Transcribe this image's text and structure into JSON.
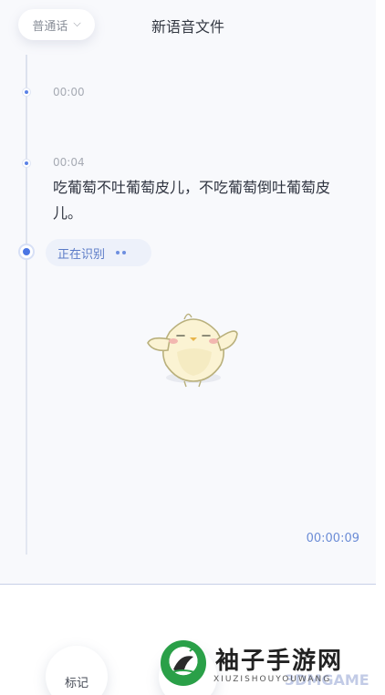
{
  "header": {
    "language_label": "普通话",
    "language_chevron_icon": "chevron-down-icon",
    "title": "新语音文件"
  },
  "timeline": {
    "entries": [
      {
        "timestamp": "00:00",
        "text": ""
      },
      {
        "timestamp": "00:04",
        "text": "吃葡萄不吐葡萄皮儿，不吃葡萄倒吐葡萄皮儿。"
      }
    ],
    "recognizing_label": "正在识别"
  },
  "mascot": {
    "icon": "chick-mascot-icon"
  },
  "recording": {
    "elapsed": "00:00:09"
  },
  "footer": {
    "mark_label": "标记"
  },
  "watermark": {
    "title": "袖子手游网",
    "subtitle": "XIUZISHOUYOUWANG",
    "overlay": "3DMGAME"
  },
  "colors": {
    "accent": "#4b76e4",
    "background": "#f8f9fc",
    "text_primary": "#2f3440",
    "timestamp": "#a7abb4",
    "elapsed": "#6b8cd6"
  }
}
